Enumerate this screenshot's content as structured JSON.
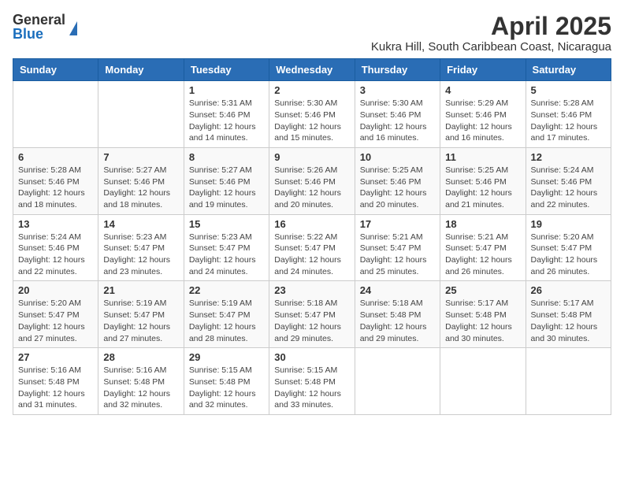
{
  "header": {
    "logo_general": "General",
    "logo_blue": "Blue",
    "title": "April 2025",
    "subtitle": "Kukra Hill, South Caribbean Coast, Nicaragua"
  },
  "days_of_week": [
    "Sunday",
    "Monday",
    "Tuesday",
    "Wednesday",
    "Thursday",
    "Friday",
    "Saturday"
  ],
  "weeks": [
    [
      {
        "day": "",
        "info": ""
      },
      {
        "day": "",
        "info": ""
      },
      {
        "day": "1",
        "info": "Sunrise: 5:31 AM\nSunset: 5:46 PM\nDaylight: 12 hours\nand 14 minutes."
      },
      {
        "day": "2",
        "info": "Sunrise: 5:30 AM\nSunset: 5:46 PM\nDaylight: 12 hours\nand 15 minutes."
      },
      {
        "day": "3",
        "info": "Sunrise: 5:30 AM\nSunset: 5:46 PM\nDaylight: 12 hours\nand 16 minutes."
      },
      {
        "day": "4",
        "info": "Sunrise: 5:29 AM\nSunset: 5:46 PM\nDaylight: 12 hours\nand 16 minutes."
      },
      {
        "day": "5",
        "info": "Sunrise: 5:28 AM\nSunset: 5:46 PM\nDaylight: 12 hours\nand 17 minutes."
      }
    ],
    [
      {
        "day": "6",
        "info": "Sunrise: 5:28 AM\nSunset: 5:46 PM\nDaylight: 12 hours\nand 18 minutes."
      },
      {
        "day": "7",
        "info": "Sunrise: 5:27 AM\nSunset: 5:46 PM\nDaylight: 12 hours\nand 18 minutes."
      },
      {
        "day": "8",
        "info": "Sunrise: 5:27 AM\nSunset: 5:46 PM\nDaylight: 12 hours\nand 19 minutes."
      },
      {
        "day": "9",
        "info": "Sunrise: 5:26 AM\nSunset: 5:46 PM\nDaylight: 12 hours\nand 20 minutes."
      },
      {
        "day": "10",
        "info": "Sunrise: 5:25 AM\nSunset: 5:46 PM\nDaylight: 12 hours\nand 20 minutes."
      },
      {
        "day": "11",
        "info": "Sunrise: 5:25 AM\nSunset: 5:46 PM\nDaylight: 12 hours\nand 21 minutes."
      },
      {
        "day": "12",
        "info": "Sunrise: 5:24 AM\nSunset: 5:46 PM\nDaylight: 12 hours\nand 22 minutes."
      }
    ],
    [
      {
        "day": "13",
        "info": "Sunrise: 5:24 AM\nSunset: 5:46 PM\nDaylight: 12 hours\nand 22 minutes."
      },
      {
        "day": "14",
        "info": "Sunrise: 5:23 AM\nSunset: 5:47 PM\nDaylight: 12 hours\nand 23 minutes."
      },
      {
        "day": "15",
        "info": "Sunrise: 5:23 AM\nSunset: 5:47 PM\nDaylight: 12 hours\nand 24 minutes."
      },
      {
        "day": "16",
        "info": "Sunrise: 5:22 AM\nSunset: 5:47 PM\nDaylight: 12 hours\nand 24 minutes."
      },
      {
        "day": "17",
        "info": "Sunrise: 5:21 AM\nSunset: 5:47 PM\nDaylight: 12 hours\nand 25 minutes."
      },
      {
        "day": "18",
        "info": "Sunrise: 5:21 AM\nSunset: 5:47 PM\nDaylight: 12 hours\nand 26 minutes."
      },
      {
        "day": "19",
        "info": "Sunrise: 5:20 AM\nSunset: 5:47 PM\nDaylight: 12 hours\nand 26 minutes."
      }
    ],
    [
      {
        "day": "20",
        "info": "Sunrise: 5:20 AM\nSunset: 5:47 PM\nDaylight: 12 hours\nand 27 minutes."
      },
      {
        "day": "21",
        "info": "Sunrise: 5:19 AM\nSunset: 5:47 PM\nDaylight: 12 hours\nand 27 minutes."
      },
      {
        "day": "22",
        "info": "Sunrise: 5:19 AM\nSunset: 5:47 PM\nDaylight: 12 hours\nand 28 minutes."
      },
      {
        "day": "23",
        "info": "Sunrise: 5:18 AM\nSunset: 5:47 PM\nDaylight: 12 hours\nand 29 minutes."
      },
      {
        "day": "24",
        "info": "Sunrise: 5:18 AM\nSunset: 5:48 PM\nDaylight: 12 hours\nand 29 minutes."
      },
      {
        "day": "25",
        "info": "Sunrise: 5:17 AM\nSunset: 5:48 PM\nDaylight: 12 hours\nand 30 minutes."
      },
      {
        "day": "26",
        "info": "Sunrise: 5:17 AM\nSunset: 5:48 PM\nDaylight: 12 hours\nand 30 minutes."
      }
    ],
    [
      {
        "day": "27",
        "info": "Sunrise: 5:16 AM\nSunset: 5:48 PM\nDaylight: 12 hours\nand 31 minutes."
      },
      {
        "day": "28",
        "info": "Sunrise: 5:16 AM\nSunset: 5:48 PM\nDaylight: 12 hours\nand 32 minutes."
      },
      {
        "day": "29",
        "info": "Sunrise: 5:15 AM\nSunset: 5:48 PM\nDaylight: 12 hours\nand 32 minutes."
      },
      {
        "day": "30",
        "info": "Sunrise: 5:15 AM\nSunset: 5:48 PM\nDaylight: 12 hours\nand 33 minutes."
      },
      {
        "day": "",
        "info": ""
      },
      {
        "day": "",
        "info": ""
      },
      {
        "day": "",
        "info": ""
      }
    ]
  ]
}
